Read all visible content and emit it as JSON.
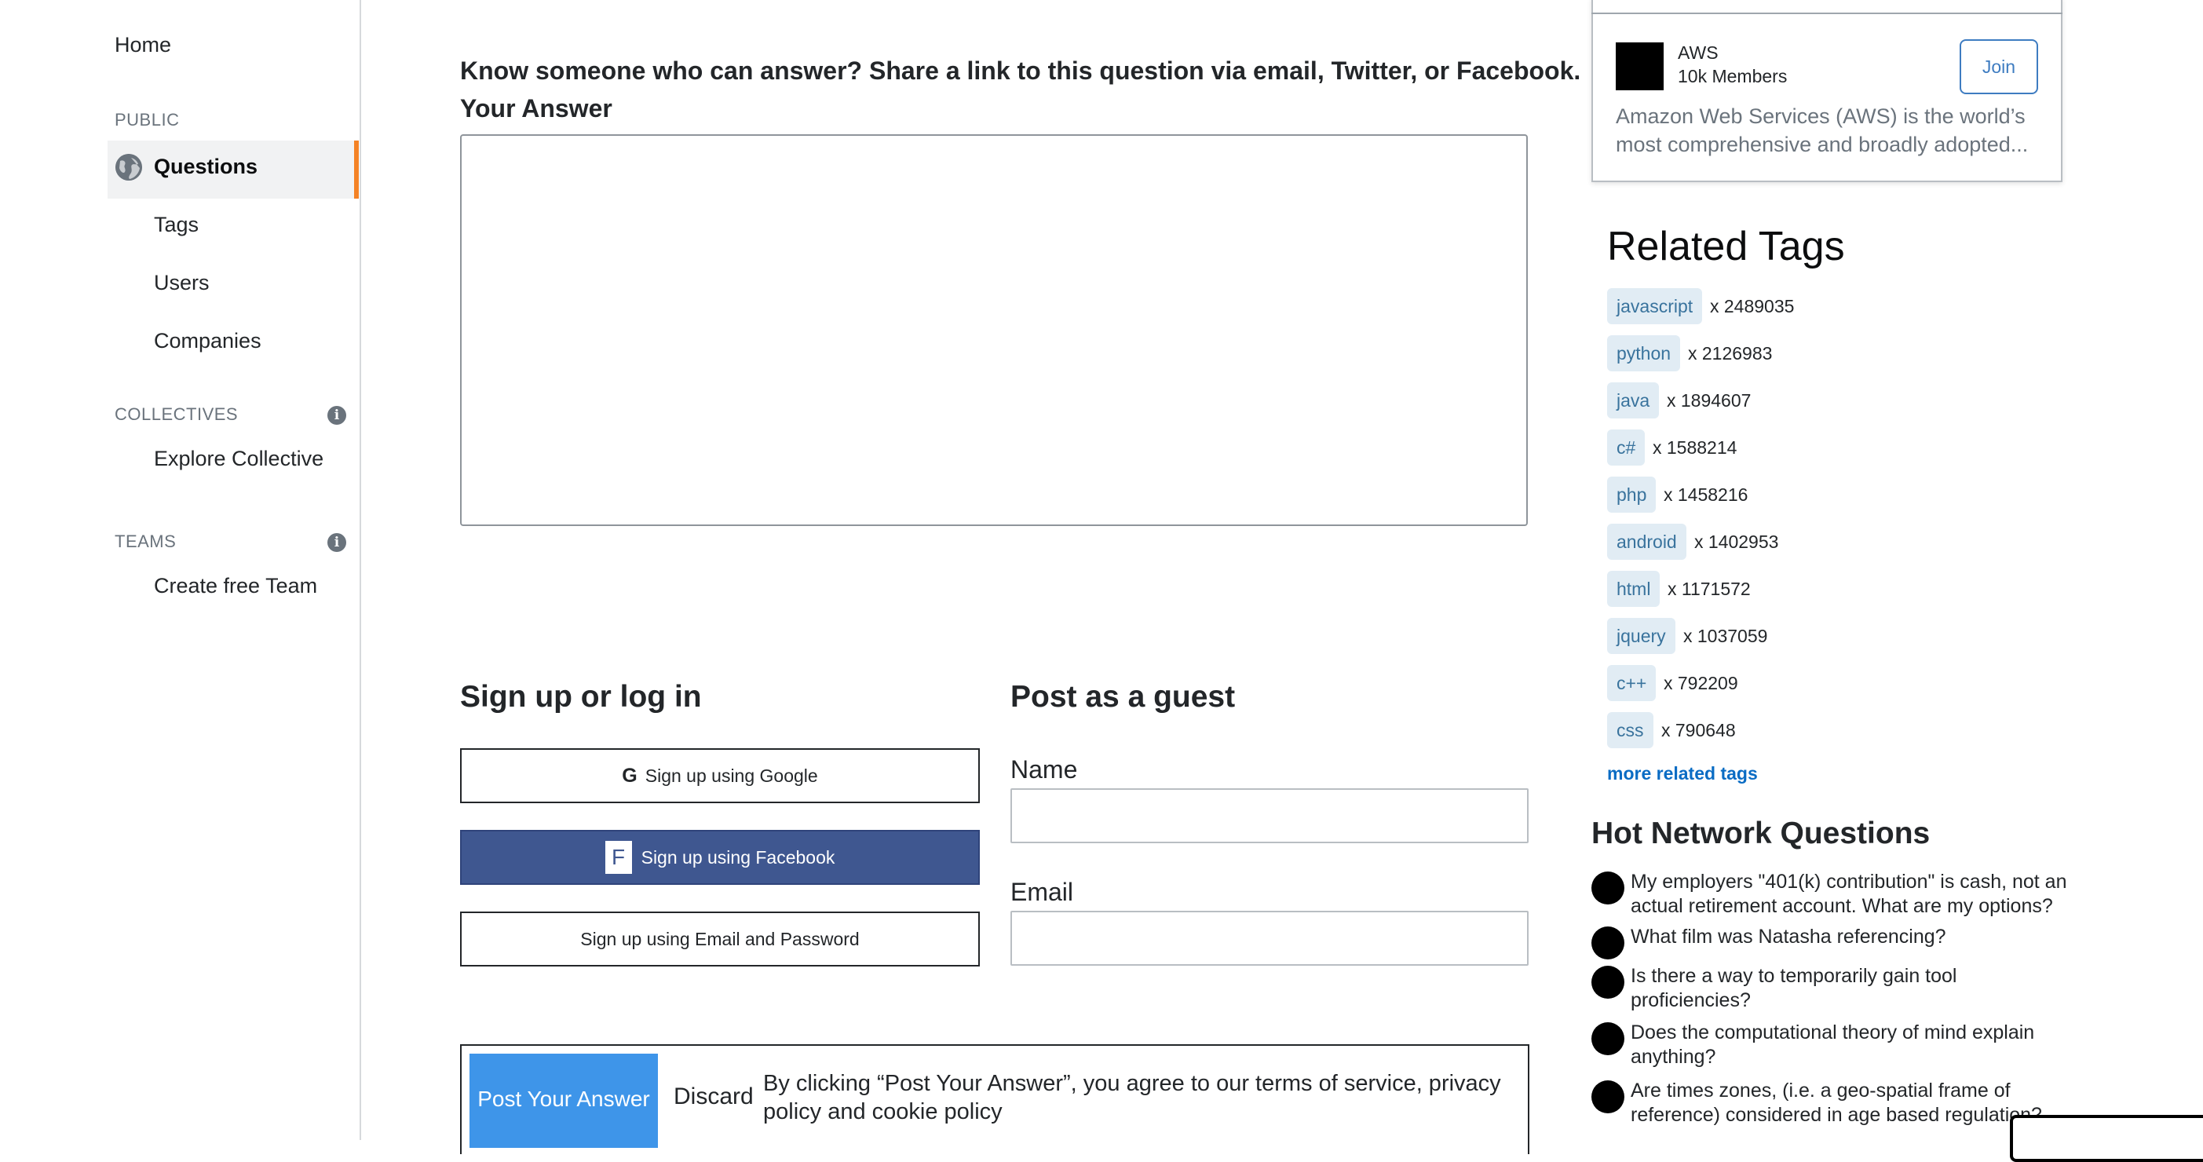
{
  "sidebar": {
    "home": "Home",
    "public_section": "PUBLIC",
    "questions": "Questions",
    "tags": "Tags",
    "users": "Users",
    "companies": "Companies",
    "collectives_section": "COLLECTIVES",
    "explore_collective": "Explore Collective",
    "teams_section": "TEAMS",
    "create_team": "Create free Team",
    "info_glyph": "i",
    "active_accent": "#f48225"
  },
  "main": {
    "share_text": "Know someone who can answer? Share a link to this question via email, Twitter, or Facebook.",
    "answer_title": "Your Answer",
    "signup": {
      "title": "Sign up or log in",
      "google_label": "Sign up using Google",
      "facebook_label": "Sign up using Facebook",
      "email_label": "Sign up using Email and Password",
      "google_glyph": "G",
      "facebook_glyph": "F"
    },
    "guest": {
      "title": "Post as a guest",
      "name_label": "Name",
      "email_label": "Email",
      "name_value": "",
      "email_value": ""
    },
    "post_button": "Post Your Answer",
    "discard": "Discard",
    "terms": "By clicking “Post Your Answer”, you agree to our terms of service, privacy policy and cookie policy",
    "post_button_color": "#3e95e9",
    "facebook_color": "#3f5790"
  },
  "collective": {
    "name": "AWS",
    "members": "10k Members",
    "join": "Join",
    "description": "Amazon Web Services (AWS) is the world’s most comprehensive and broadly adopted..."
  },
  "related_tags": {
    "title": "Related Tags",
    "items": [
      {
        "name": "javascript",
        "count": "x 2489035"
      },
      {
        "name": "python",
        "count": "x 2126983"
      },
      {
        "name": "java",
        "count": "x 1894607"
      },
      {
        "name": "c#",
        "count": "x 1588214"
      },
      {
        "name": "php",
        "count": "x 1458216"
      },
      {
        "name": "android",
        "count": "x 1402953"
      },
      {
        "name": "html",
        "count": "x 1171572"
      },
      {
        "name": "jquery",
        "count": "x 1037059"
      },
      {
        "name": "c++",
        "count": "x 792209"
      },
      {
        "name": "css",
        "count": "x 790648"
      }
    ],
    "more": "more related tags"
  },
  "hot_network": {
    "title": "Hot Network Questions",
    "items": [
      "My employers \"401(k) contribution\" is cash, not an actual retirement account. What are my options?",
      "What film was Natasha referencing?",
      "Is there a way to temporarily gain tool proficiencies?",
      "Does the computational theory of mind explain anything?",
      "Are times zones, (i.e. a geo-spatial frame of reference) considered in age based regulation?"
    ]
  }
}
